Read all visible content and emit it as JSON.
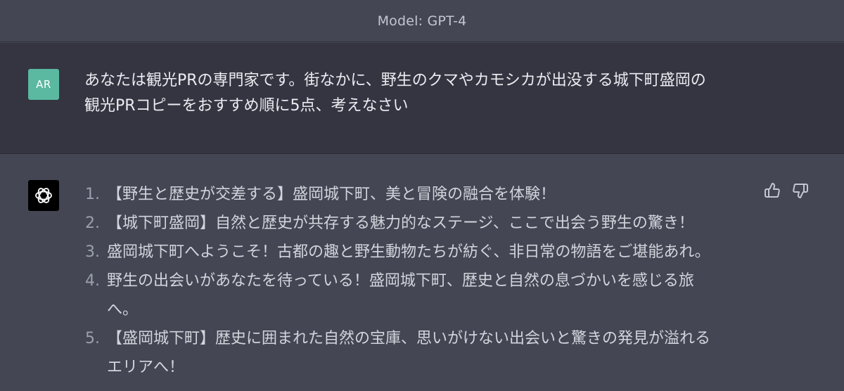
{
  "header": {
    "title": "Model: GPT-4"
  },
  "user_message": {
    "avatar_initials": "AR",
    "avatar_color": "#5ab9a0",
    "lines": [
      "あなたは観光PRの専門家です。街なかに、野生のクマやカモシカが出没する城下町盛岡の",
      "観光PRコピーをおすすめ順に5点、考えなさい"
    ]
  },
  "assistant_message": {
    "avatar_icon": "openai-logo-icon",
    "items": [
      {
        "num": "1.",
        "lines": [
          "【野生と歴史が交差する】盛岡城下町、美と冒険の融合を体験！"
        ]
      },
      {
        "num": "2.",
        "lines": [
          "【城下町盛岡】自然と歴史が共存する魅力的なステージ、ここで出会う野生の驚き！"
        ]
      },
      {
        "num": "3.",
        "lines": [
          "盛岡城下町へようこそ！古都の趣と野生動物たちが紡ぐ、非日常の物語をご堪能あれ。"
        ]
      },
      {
        "num": "4.",
        "lines": [
          "野生の出会いがあなたを待っている！盛岡城下町、歴史と自然の息づかいを感じる旅",
          "へ。"
        ]
      },
      {
        "num": "5.",
        "lines": [
          "【盛岡城下町】歴史に囲まれた自然の宝庫、思いがけない出会いと驚きの発見が溢れる",
          "エリアへ！"
        ]
      }
    ],
    "feedback": {
      "like_icon": "thumbs-up-icon",
      "dislike_icon": "thumbs-down-icon"
    }
  },
  "colors": {
    "page_bg": "#444654",
    "user_row_bg": "#343541",
    "text_primary": "#ececf1",
    "text_answer": "#d1d5db"
  }
}
